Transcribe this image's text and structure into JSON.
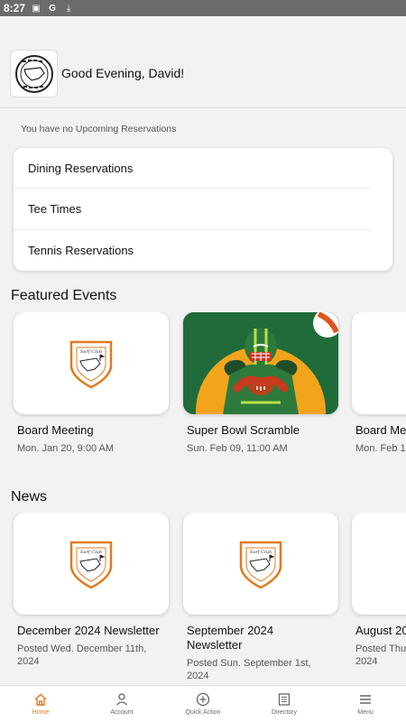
{
  "status_bar": {
    "time": "8:27"
  },
  "header": {
    "greeting": "Good Evening, David!"
  },
  "reservations": {
    "empty_message": "You have no Upcoming Reservations",
    "items": [
      "Dining Reservations",
      "Tee Times",
      "Tennis Reservations"
    ]
  },
  "featured_events": {
    "title": "Featured Events",
    "items": [
      {
        "title": "Board Meeting",
        "date": "Mon. Jan 20, 9:00 AM"
      },
      {
        "title": "Super Bowl Scramble",
        "date": "Sun. Feb 09, 11:00 AM"
      },
      {
        "title": "Board Me",
        "date": "Mon. Feb 1"
      }
    ]
  },
  "news": {
    "title": "News",
    "items": [
      {
        "title": "December 2024 Newsletter",
        "date": "Posted Wed. December 11th, 2024"
      },
      {
        "title": "September 2024 Newsletter",
        "date": "Posted Sun. September 1st, 2024"
      },
      {
        "title": "August 20",
        "date": "Posted Thu 2024"
      }
    ]
  },
  "bottom_nav": {
    "items": [
      {
        "label": "Home",
        "icon": "home-icon"
      },
      {
        "label": "Account",
        "icon": "person-icon"
      },
      {
        "label": "Quick Action",
        "icon": "plus-circle-icon"
      },
      {
        "label": "Directory",
        "icon": "list-icon"
      },
      {
        "label": "Menu",
        "icon": "hamburger-icon"
      }
    ]
  },
  "colors": {
    "accent": "#e07b1f",
    "background": "#f2f2f2"
  }
}
